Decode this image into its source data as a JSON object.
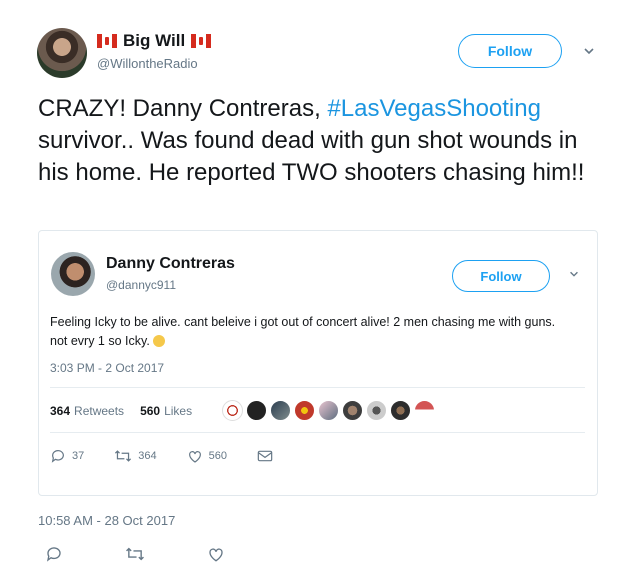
{
  "author": {
    "name": "Big Will",
    "handle": "@WillontheRadio",
    "follow_label": "Follow"
  },
  "tweet": {
    "text_before": "CRAZY! Danny Contreras, ",
    "hashtag": "#LasVegasShooting",
    "text_after": " survivor.. Was found dead with gun shot wounds in his home. He reported TWO shooters chasing him!!",
    "timestamp": "10:58 AM - 28 Oct 2017"
  },
  "quoted": {
    "name": "Danny Contreras",
    "handle": "@dannyc911",
    "follow_label": "Follow",
    "text": "Feeling Icky to be alive. cant beleive i got out of concert alive! 2 men chasing me with guns. not evry 1 so Icky.",
    "time": "3:03 PM - 2 Oct 2017",
    "retweets_count": "364",
    "retweets_label": "Retweets",
    "likes_count": "560",
    "likes_label": "Likes",
    "reply_count": "37",
    "retweet_count": "364",
    "like_count": "560"
  },
  "colors": {
    "accent": "#1da1f2",
    "link": "#1b95e0",
    "secondary_text": "#657786"
  },
  "icons": [
    "chevron-down-icon",
    "reply-icon",
    "retweet-icon",
    "like-icon",
    "message-icon",
    "canada-flag-icon"
  ]
}
